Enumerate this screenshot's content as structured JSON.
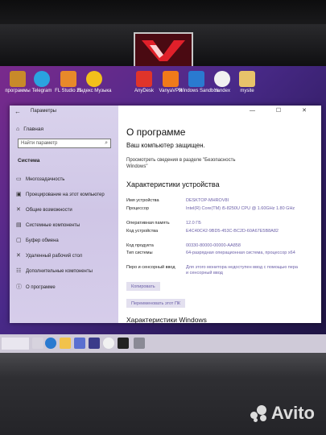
{
  "desktop_icons": [
    {
      "label": "программы",
      "color": "#c88a2a"
    },
    {
      "label": "Telegram",
      "color": "#2aa3e0"
    },
    {
      "label": "FL Studio 21",
      "color": "#e8892a"
    },
    {
      "label": "Яндекс Музыка",
      "color": "#f2c01b"
    },
    {
      "label": "AnyDesk",
      "color": "#e0342a"
    },
    {
      "label": "VanyaVPN",
      "color": "#f07a1a"
    },
    {
      "label": "Windows Sandbox",
      "color": "#2a7ad0"
    },
    {
      "label": "Yandex",
      "color": "#f1f1f1"
    },
    {
      "label": "mysite",
      "color": "#e8c36a"
    }
  ],
  "window": {
    "title": "Параметры",
    "controls": "— ☐ ✕"
  },
  "sidebar": {
    "home_label": "Главная",
    "search_placeholder": "Найти параметр",
    "section_title": "Система",
    "items": [
      {
        "label": "Многозадачность",
        "icon": "multitask-icon"
      },
      {
        "label": "Проецирование на этот компьютер",
        "icon": "project-icon"
      },
      {
        "label": "Общие возможности",
        "icon": "shared-icon"
      },
      {
        "label": "Системные компоненты",
        "icon": "components-icon"
      },
      {
        "label": "Буфер обмена",
        "icon": "clipboard-icon"
      },
      {
        "label": "Удаленный рабочий стол",
        "icon": "remote-icon"
      },
      {
        "label": "Дополнительные компоненты",
        "icon": "addons-icon"
      },
      {
        "label": "О программе",
        "icon": "info-icon"
      }
    ]
  },
  "content": {
    "title": "О программе",
    "protected": "Ваш компьютер защищен.",
    "protect_link": "Просмотреть сведения в разделе \"Безопасность Windows\"",
    "specs_title": "Характеристики устройства",
    "specs": [
      {
        "key": "Имя устройства",
        "value": "DESKTOP-MHROV8I"
      },
      {
        "key": "Процессор",
        "value": "Intel(R) Core(TM) i5-8250U CPU @ 1.60GHz 1.80 GHz"
      },
      {
        "key": "Оперативная память",
        "value": "12.0 ГБ"
      },
      {
        "key": "Код устройства",
        "value": "E4C40C42-9BD5-453C-BC2D-60A67E5B8A82"
      },
      {
        "key": "Код продукта",
        "value": "00330-80000-00000-AA858"
      },
      {
        "key": "Тип системы",
        "value": "64-разрядная операционная система, процессор x64"
      },
      {
        "key": "Перо и сенсорный ввод",
        "value": "Для этого монитора недоступен ввод с помощью пера и сенсорный ввод"
      }
    ],
    "copy_button": "Копировать",
    "rename_button": "Переименовать этот ПК",
    "windows_specs_title": "Характеристики Windows"
  },
  "watermark": "Avito"
}
